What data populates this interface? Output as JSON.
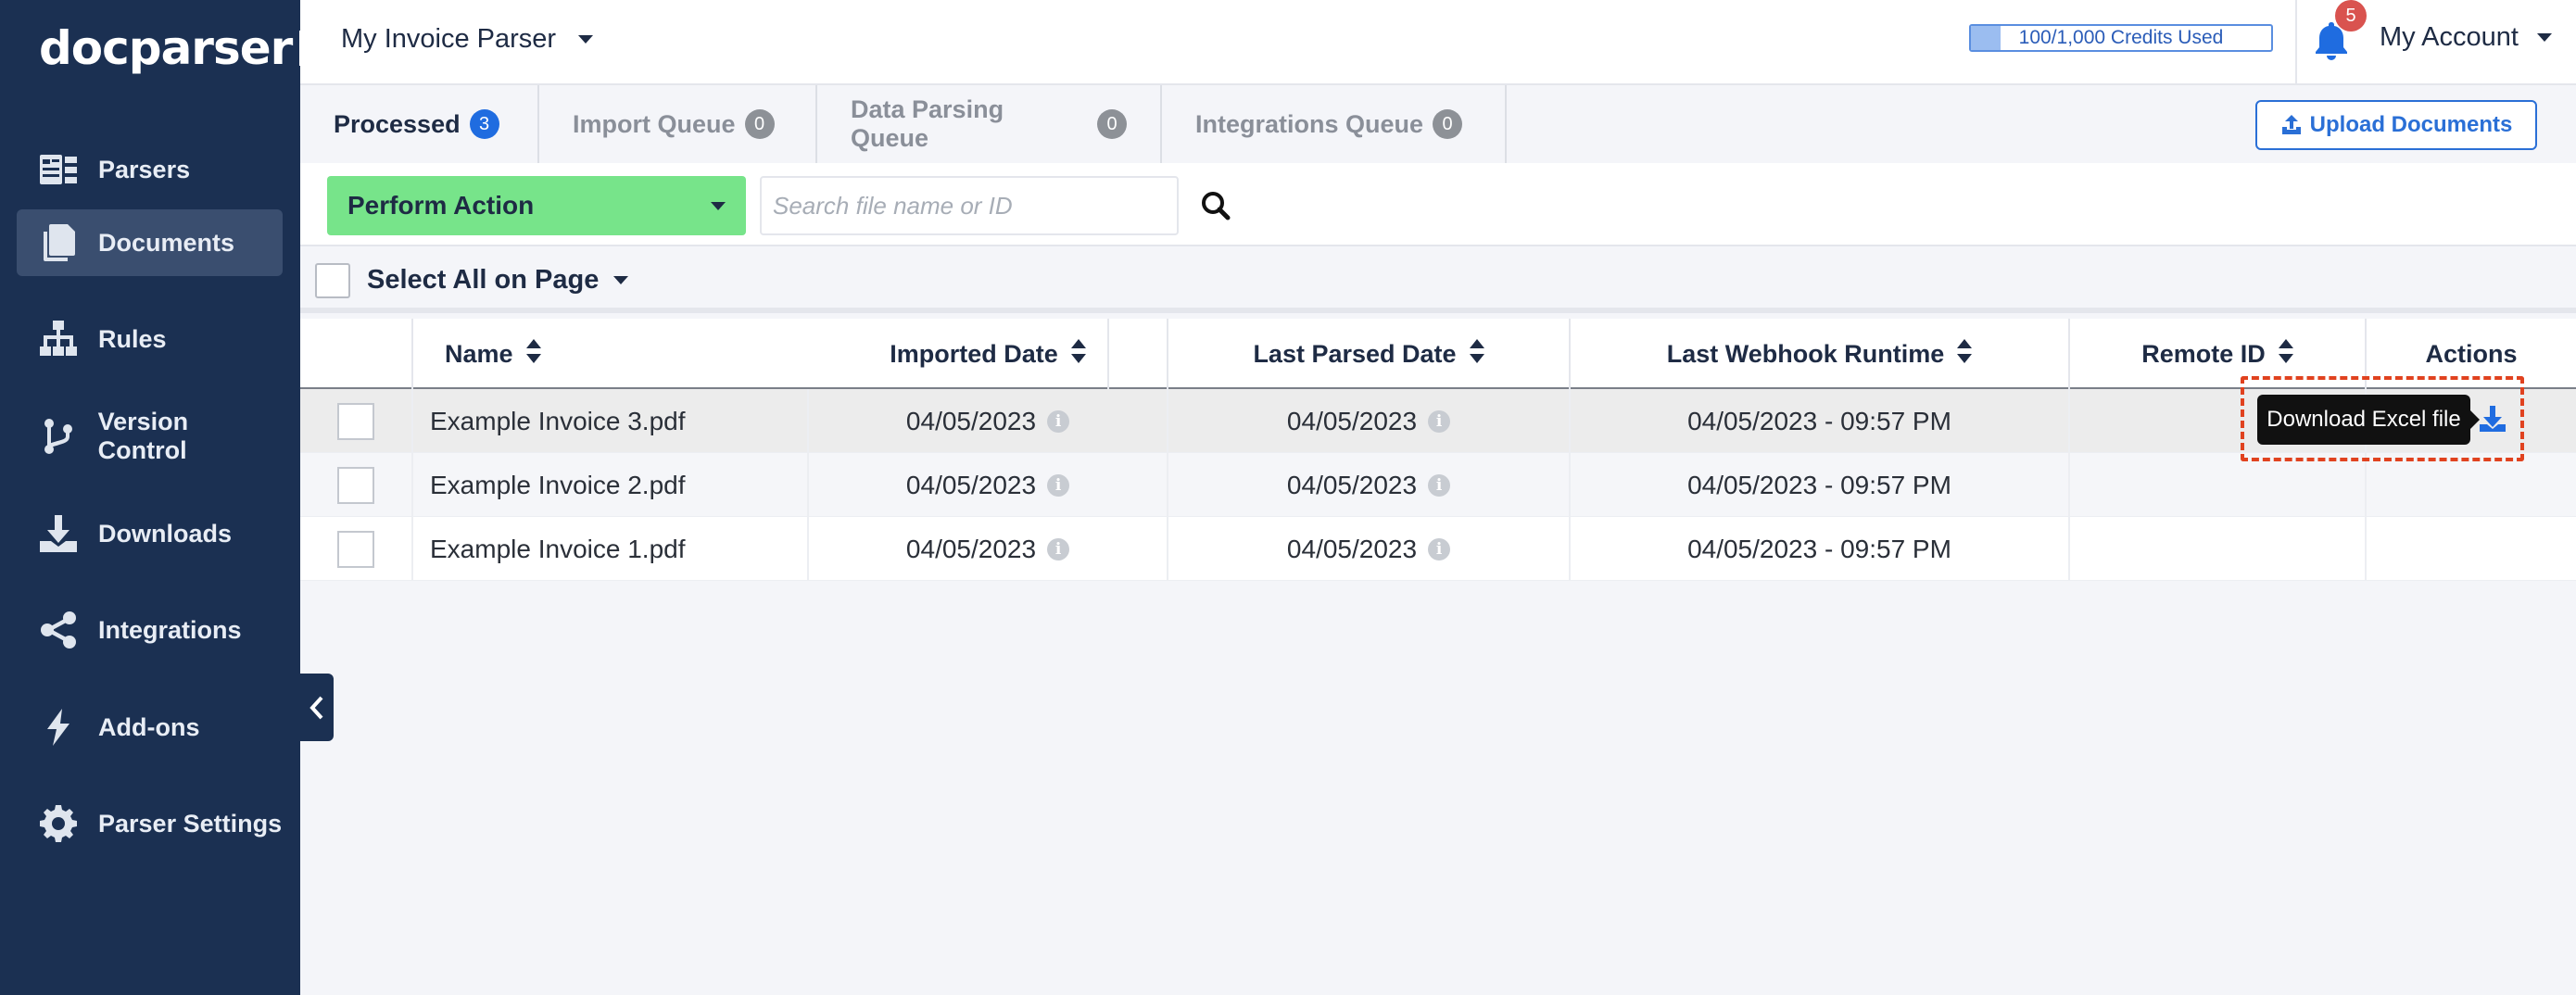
{
  "app": {
    "logo_text": "docparser",
    "parser_name": "My Invoice Parser",
    "credits": {
      "text": "100/1,000 Credits Used",
      "used": 100,
      "total": 1000
    },
    "notifications_count": "5",
    "account_label": "My Account"
  },
  "sidebar": {
    "items": [
      {
        "label": "Parsers",
        "icon": "parsers-icon"
      },
      {
        "label": "Documents",
        "icon": "documents-icon"
      },
      {
        "label": "Rules",
        "icon": "rules-icon"
      },
      {
        "label": "Version Control",
        "icon": "version-control-icon"
      },
      {
        "label": "Downloads",
        "icon": "downloads-icon"
      },
      {
        "label": "Integrations",
        "icon": "integrations-icon"
      },
      {
        "label": "Add-ons",
        "icon": "addons-icon"
      },
      {
        "label": "Parser Settings",
        "icon": "gear-icon"
      }
    ],
    "active": "Documents"
  },
  "tabs": [
    {
      "label": "Processed",
      "count": "3"
    },
    {
      "label": "Import Queue",
      "count": "0"
    },
    {
      "label": "Data Parsing Queue",
      "count": "0"
    },
    {
      "label": "Integrations Queue",
      "count": "0"
    }
  ],
  "upload_label": "Upload Documents",
  "toolbar": {
    "perform_action_label": "Perform Action",
    "search_placeholder": "Search file name or ID",
    "select_all_label": "Select All on Page"
  },
  "table": {
    "columns": [
      "Name",
      "Imported Date",
      "Last Parsed Date",
      "Last Webhook Runtime",
      "Remote ID",
      "Actions"
    ],
    "rows": [
      {
        "name": "Example Invoice 3.pdf",
        "imported": "04/05/2023",
        "parsed": "04/05/2023",
        "webhook": "04/05/2023 - 09:57 PM",
        "remote_id": ""
      },
      {
        "name": "Example Invoice 2.pdf",
        "imported": "04/05/2023",
        "parsed": "04/05/2023",
        "webhook": "04/05/2023 - 09:57 PM",
        "remote_id": ""
      },
      {
        "name": "Example Invoice 1.pdf",
        "imported": "04/05/2023",
        "parsed": "04/05/2023",
        "webhook": "04/05/2023 - 09:57 PM",
        "remote_id": ""
      }
    ]
  },
  "tooltip_text": "Download Excel file",
  "colors": {
    "sidebar_bg": "#1b3052",
    "accent_blue": "#1f6ce0",
    "action_green": "#77e48a",
    "badge_red": "#d9534f",
    "highlight_red": "#e0421f"
  }
}
